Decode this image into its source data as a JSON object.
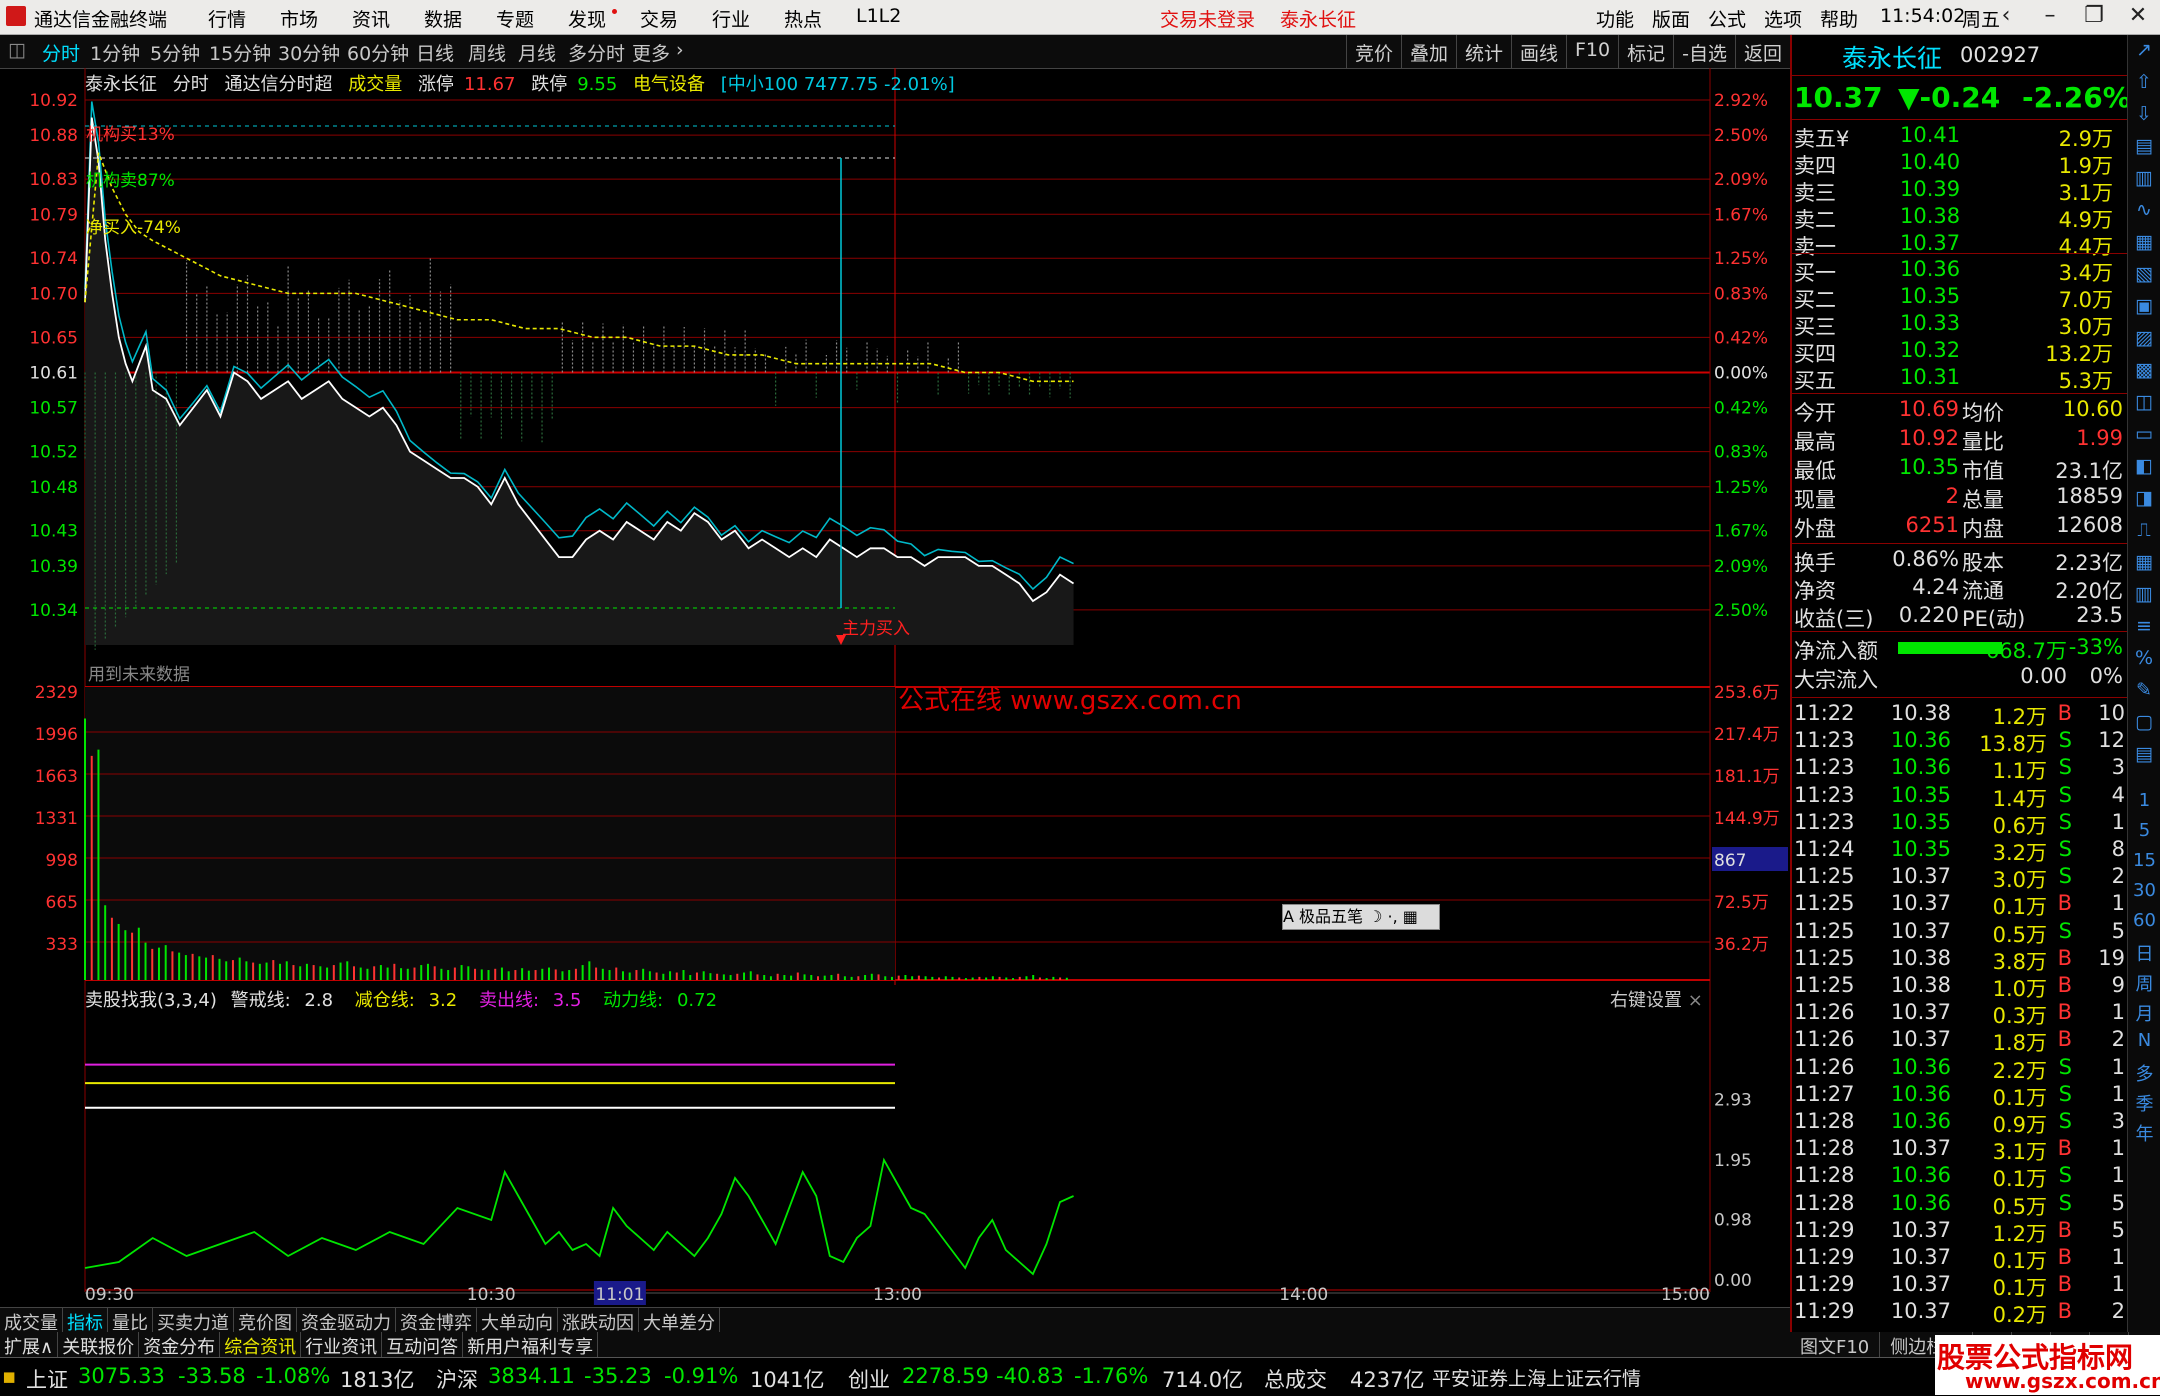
{
  "titlebar": {
    "app_title": "通达信金融终端",
    "menu": [
      "行情",
      "市场",
      "资讯",
      "数据",
      "专题",
      "发现",
      "交易",
      "行业",
      "热点",
      "L1L2"
    ],
    "status": "交易未登录",
    "stock": "泰永长征",
    "right_menu": [
      "功能",
      "版面",
      "公式",
      "选项",
      "帮助"
    ],
    "clock": "11:54:02",
    "weekday": "周五"
  },
  "periodbar": {
    "tabs": [
      "分时",
      "1分钟",
      "5分钟",
      "15分钟",
      "30分钟",
      "60分钟",
      "日线",
      "周线",
      "月线",
      "多分时",
      "更多"
    ],
    "tools": [
      "竞价",
      "叠加",
      "统计",
      "画线",
      "F10",
      "标记",
      "-自选",
      "返回"
    ]
  },
  "infoline": {
    "name": "泰永长征",
    "mode": "分时",
    "formula": "通达信分时超",
    "vol": "成交量",
    "limit_up_label": "涨停",
    "limit_up": "11.67",
    "limit_down_label": "跌停",
    "limit_down": "9.55",
    "sector": "电气设备",
    "index_info": "[中小100 7477.75 -2.01%]"
  },
  "chart_data": {
    "type": "line",
    "title": "泰永长征 分时",
    "prev_close": 10.61,
    "price_ticks": [
      "10.92",
      "10.88",
      "10.83",
      "10.79",
      "10.74",
      "10.70",
      "10.65",
      "10.61",
      "10.57",
      "10.52",
      "10.48",
      "10.43",
      "10.39",
      "10.34"
    ],
    "pct_ticks": [
      "2.92%",
      "2.50%",
      "2.09%",
      "1.67%",
      "1.25%",
      "0.83%",
      "0.42%",
      "0.00%",
      "0.42%",
      "0.83%",
      "1.25%",
      "1.67%",
      "2.09%",
      "2.50%"
    ],
    "ylim": [
      10.3,
      10.92
    ],
    "time_ticks": [
      "09:30",
      "10:30",
      "11:01",
      "13:00",
      "14:00",
      "15:00"
    ],
    "price_x": [
      0,
      1,
      2,
      3,
      4,
      5,
      6,
      7,
      8,
      9,
      10,
      12,
      14,
      16,
      18,
      20,
      22,
      24,
      26,
      28,
      30,
      32,
      34,
      36,
      38,
      40,
      42,
      44,
      46,
      48,
      50,
      52,
      54,
      56,
      58,
      60,
      62,
      64,
      66,
      68,
      70,
      72,
      74,
      76,
      78,
      80,
      82,
      84,
      86,
      88,
      90,
      92,
      94,
      96,
      98,
      100,
      102,
      104,
      106,
      108,
      110,
      112,
      114,
      116,
      118,
      120,
      122,
      124,
      126,
      128,
      130,
      132,
      134,
      136,
      138,
      140,
      142,
      144,
      146
    ],
    "price": [
      10.69,
      10.9,
      10.85,
      10.76,
      10.7,
      10.65,
      10.62,
      10.6,
      10.62,
      10.64,
      10.59,
      10.58,
      10.55,
      10.57,
      10.59,
      10.56,
      10.61,
      10.6,
      10.58,
      10.59,
      10.6,
      10.58,
      10.59,
      10.6,
      10.58,
      10.57,
      10.56,
      10.57,
      10.55,
      10.52,
      10.51,
      10.5,
      10.49,
      10.49,
      10.48,
      10.46,
      10.49,
      10.46,
      10.44,
      10.42,
      10.4,
      10.4,
      10.42,
      10.43,
      10.42,
      10.44,
      10.43,
      10.42,
      10.44,
      10.43,
      10.45,
      10.44,
      10.42,
      10.43,
      10.41,
      10.42,
      10.41,
      10.4,
      10.41,
      10.4,
      10.42,
      10.41,
      10.4,
      10.41,
      10.41,
      10.4,
      10.4,
      10.39,
      10.4,
      10.4,
      10.4,
      10.39,
      10.39,
      10.38,
      10.37,
      10.35,
      10.36,
      10.38,
      10.37
    ],
    "avg_x": [
      0,
      2,
      4,
      6,
      8,
      10,
      15,
      20,
      25,
      30,
      35,
      40,
      45,
      50,
      55,
      60,
      65,
      70,
      75,
      80,
      85,
      90,
      95,
      100,
      105,
      110,
      115,
      120,
      125,
      130,
      135,
      140,
      146
    ],
    "avg": [
      10.69,
      10.86,
      10.82,
      10.79,
      10.77,
      10.76,
      10.74,
      10.72,
      10.71,
      10.7,
      10.7,
      10.7,
      10.69,
      10.68,
      10.67,
      10.67,
      10.66,
      10.66,
      10.65,
      10.65,
      10.64,
      10.64,
      10.63,
      10.63,
      10.62,
      10.62,
      10.62,
      10.62,
      10.62,
      10.61,
      10.61,
      10.6,
      10.6
    ],
    "annotations": [
      "机构买13%",
      "机构卖87%",
      "净买入-74%",
      "主力买入"
    ],
    "future_label": "用到未来数据",
    "volume_ticks_left": [
      "2329",
      "1996",
      "1663",
      "1331",
      "998",
      "665",
      "333"
    ],
    "volume_ticks_right": [
      "253.6万",
      "217.4万",
      "181.1万",
      "144.9万",
      "108.7万",
      "72.5万",
      "36.2万"
    ],
    "volume_marker": "867",
    "volume": [
      2100,
      1800,
      1850,
      600,
      500,
      450,
      400,
      380,
      420,
      300,
      250,
      260,
      280,
      230,
      220,
      200,
      210,
      190,
      180,
      200,
      170,
      150,
      160,
      180,
      150,
      140,
      130,
      140,
      160,
      130,
      150,
      120,
      110,
      130,
      120,
      110,
      100,
      120,
      140,
      150,
      110,
      100,
      90,
      110,
      120,
      100,
      130,
      95,
      90,
      100,
      120,
      130,
      110,
      90,
      80,
      100,
      120,
      110,
      90,
      85,
      80,
      90,
      100,
      70,
      80,
      95,
      75,
      80,
      90,
      100,
      85,
      70,
      80,
      90,
      120,
      150,
      100,
      90,
      80,
      100,
      70,
      60,
      80,
      90,
      70,
      60,
      50,
      70,
      60,
      80,
      40,
      60,
      70,
      55,
      50,
      45,
      40,
      50,
      60,
      70,
      45,
      40,
      30,
      50,
      40,
      35,
      60,
      45,
      40,
      30,
      35,
      40,
      50,
      30,
      25,
      30,
      40,
      50,
      45,
      30,
      25,
      35,
      40,
      30,
      35,
      30,
      25,
      20,
      30,
      25,
      20,
      15,
      20,
      25,
      20,
      30,
      25,
      20,
      15,
      25,
      30,
      40,
      20,
      15,
      25,
      20,
      18
    ],
    "indicator": {
      "name": "卖股找我(3,3,4)",
      "warn_label": "警戒线:",
      "warn": 2.8,
      "reduce_label": "减仓线:",
      "reduce": 3.2,
      "sell_label": "卖出线:",
      "sell": 3.5,
      "power_label": "动力线:",
      "power": 0.72,
      "ticks": [
        "2.93",
        "1.95",
        "0.98",
        "0.00"
      ],
      "x": [
        0,
        5,
        10,
        15,
        20,
        25,
        30,
        35,
        40,
        45,
        50,
        55,
        60,
        62,
        64,
        66,
        68,
        70,
        72,
        74,
        76,
        78,
        80,
        82,
        84,
        86,
        88,
        90,
        92,
        94,
        96,
        98,
        100,
        102,
        104,
        106,
        108,
        110,
        112,
        114,
        116,
        118,
        120,
        122,
        124,
        126,
        128,
        130,
        132,
        134,
        136,
        138,
        140,
        142,
        144,
        146
      ],
      "y": [
        0.1,
        0.15,
        0.35,
        0.2,
        0.3,
        0.4,
        0.2,
        0.35,
        0.25,
        0.4,
        0.3,
        0.6,
        0.5,
        0.9,
        0.7,
        0.5,
        0.3,
        0.4,
        0.25,
        0.3,
        0.2,
        0.6,
        0.45,
        0.35,
        0.25,
        0.4,
        0.3,
        0.2,
        0.35,
        0.55,
        0.85,
        0.7,
        0.5,
        0.3,
        0.6,
        0.9,
        0.7,
        0.2,
        0.15,
        0.35,
        0.45,
        1.0,
        0.8,
        0.6,
        0.55,
        0.4,
        0.25,
        0.1,
        0.35,
        0.5,
        0.25,
        0.15,
        0.05,
        0.3,
        0.65,
        0.7
      ]
    }
  },
  "watermark": "公式在线 www.gszx.com.cn",
  "jipin": "A 极品五笔 ☽ ·, ▦",
  "right": {
    "name": "泰永长征",
    "code": "002927",
    "price": "10.37",
    "change": "▼-0.24",
    "pct": "-2.26%",
    "asks": [
      {
        "label": "卖五",
        "tag": "¥",
        "price": "10.41",
        "vol": "2.9万"
      },
      {
        "label": "卖四",
        "tag": "",
        "price": "10.40",
        "vol": "1.9万"
      },
      {
        "label": "卖三",
        "tag": "",
        "price": "10.39",
        "vol": "3.1万"
      },
      {
        "label": "卖二",
        "tag": "",
        "price": "10.38",
        "vol": "4.9万"
      },
      {
        "label": "卖一",
        "tag": "",
        "price": "10.37",
        "vol": "4.4万"
      }
    ],
    "bids": [
      {
        "label": "买一",
        "price": "10.36",
        "vol": "3.4万"
      },
      {
        "label": "买二",
        "price": "10.35",
        "vol": "7.0万"
      },
      {
        "label": "买三",
        "price": "10.33",
        "vol": "3.0万"
      },
      {
        "label": "买四",
        "price": "10.32",
        "vol": "13.2万"
      },
      {
        "label": "买五",
        "price": "10.31",
        "vol": "5.3万"
      }
    ],
    "stats1": [
      {
        "l1": "今开",
        "v1": "10.69",
        "l2": "均价",
        "v2": "10.60"
      },
      {
        "l1": "最高",
        "v1": "10.92",
        "l2": "量比",
        "v2": "1.99"
      },
      {
        "l1": "最低",
        "v1": "10.35",
        "l2": "市值",
        "v2": "23.1亿"
      },
      {
        "l1": "现量",
        "v1": "2",
        "l2": "总量",
        "v2": "18859"
      },
      {
        "l1": "外盘",
        "v1": "6251",
        "l2": "内盘",
        "v2": "12608"
      }
    ],
    "stats2": [
      {
        "l1": "换手",
        "v1": "0.86%",
        "l2": "股本",
        "v2": "2.23亿"
      },
      {
        "l1": "净资",
        "v1": "4.24",
        "l2": "流通",
        "v2": "2.20亿"
      },
      {
        "l1": "收益(三)",
        "v1": "0.220",
        "l2": "PE(动)",
        "v2": "23.5"
      }
    ],
    "flow": [
      {
        "label": "净流入额",
        "val": "-668.7万",
        "pct": "-33%"
      },
      {
        "label": "大宗流入",
        "val": "0.00",
        "pct": "0%"
      }
    ],
    "trades": [
      [
        "11:22",
        "10.38",
        "1.2万",
        "B",
        "10"
      ],
      [
        "11:23",
        "10.36",
        "13.8万",
        "S",
        "12"
      ],
      [
        "11:23",
        "10.36",
        "1.1万",
        "S",
        "3"
      ],
      [
        "11:23",
        "10.35",
        "1.4万",
        "S",
        "4"
      ],
      [
        "11:23",
        "10.35",
        "0.6万",
        "S",
        "1"
      ],
      [
        "11:24",
        "10.35",
        "3.2万",
        "S",
        "8"
      ],
      [
        "11:25",
        "10.37",
        "3.0万",
        "S",
        "2"
      ],
      [
        "11:25",
        "10.37",
        "0.1万",
        "B",
        "1"
      ],
      [
        "11:25",
        "10.37",
        "0.5万",
        "S",
        "5"
      ],
      [
        "11:25",
        "10.38",
        "3.8万",
        "B",
        "19"
      ],
      [
        "11:25",
        "10.38",
        "1.0万",
        "B",
        "9"
      ],
      [
        "11:26",
        "10.37",
        "0.3万",
        "B",
        "1"
      ],
      [
        "11:26",
        "10.37",
        "1.8万",
        "B",
        "2"
      ],
      [
        "11:26",
        "10.36",
        "2.2万",
        "S",
        "1"
      ],
      [
        "11:27",
        "10.36",
        "0.1万",
        "S",
        "1"
      ],
      [
        "11:28",
        "10.36",
        "0.9万",
        "S",
        "3"
      ],
      [
        "11:28",
        "10.37",
        "3.1万",
        "B",
        "1"
      ],
      [
        "11:28",
        "10.36",
        "0.1万",
        "S",
        "1"
      ],
      [
        "11:28",
        "10.36",
        "0.5万",
        "S",
        "5"
      ],
      [
        "11:29",
        "10.37",
        "1.2万",
        "B",
        "5"
      ],
      [
        "11:29",
        "10.37",
        "0.1万",
        "B",
        "1"
      ],
      [
        "11:29",
        "10.37",
        "0.1万",
        "B",
        "1"
      ],
      [
        "11:29",
        "10.37",
        "0.2万",
        "B",
        "2"
      ]
    ]
  },
  "strip": [
    "1",
    "5",
    "15",
    "30",
    "60",
    "日",
    "周",
    "月",
    "N",
    "多",
    "季",
    "年"
  ],
  "bottabs": [
    "成交量",
    "指标",
    "量比",
    "买卖力道",
    "竞价图",
    "资金驱动力",
    "资金博弈",
    "大单动向",
    "涨跌动因",
    "大单差分"
  ],
  "infotabs": [
    "扩展∧",
    "关联报价",
    "资金分布",
    "综合资讯",
    "行业资讯",
    "互动问答",
    "新用户福利专享"
  ],
  "rbot": [
    "图文F10",
    "侧边栏《",
    "笔",
    "价",
    "细",
    "盘"
  ],
  "statusbar": {
    "sh_label": "上证",
    "sh": "3075.33",
    "sh_chg": "-33.58",
    "sh_pct": "-1.08%",
    "sh_amt": "1813亿",
    "hs_label": "沪深",
    "hs": "3834.11",
    "hs_chg": "-35.23",
    "hs_pct": "-0.91%",
    "hs_amt": "1041亿",
    "cy_label": "创业",
    "cy": "2278.59",
    "cy_chg": "-40.83",
    "cy_pct": "-1.76%",
    "cy_amt": "714.0亿",
    "total_label": "总成交",
    "total": "4237亿",
    "broker": "平安证券上海上证云行情"
  },
  "brand": {
    "line1": "股票公式指标网",
    "line2": "www.gszx.com.cn"
  },
  "colors": {
    "up": "#ff3232",
    "down": "#00e600",
    "grid": "#8a0000",
    "price_line": "#ffffff",
    "avg_line": "#e8e800",
    "cyan": "#00e0ff"
  }
}
